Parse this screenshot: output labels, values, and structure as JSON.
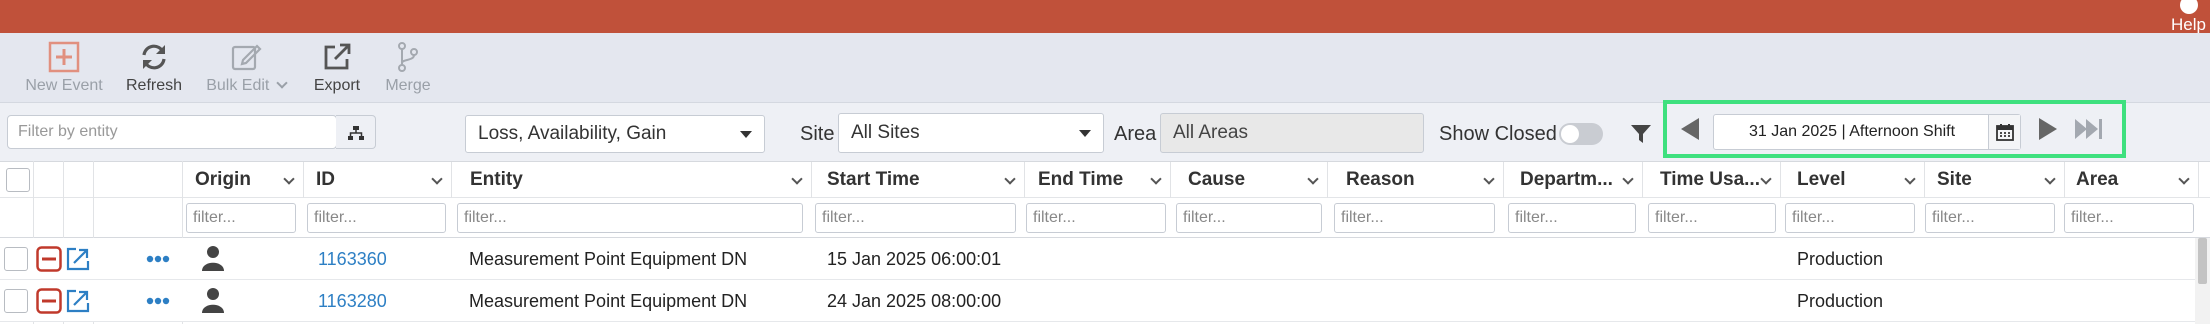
{
  "header": {
    "help_label": "Help"
  },
  "toolbar": {
    "new_event": "New Event",
    "refresh": "Refresh",
    "bulk_edit": "Bulk Edit",
    "export": "Export",
    "merge": "Merge"
  },
  "filters": {
    "entity_placeholder": "Filter by entity",
    "event_types": "Loss, Availability, Gain",
    "site_label": "Site",
    "site_value": "All Sites",
    "area_label": "Area",
    "area_value": "All Areas",
    "show_closed_label": "Show Closed",
    "show_closed_on": false
  },
  "date_nav": {
    "date": "31 Jan 2025",
    "separator": " | ",
    "shift": "Afternoon Shift"
  },
  "grid": {
    "columns": [
      "Origin",
      "ID",
      "Entity",
      "Start Time",
      "End Time",
      "Cause",
      "Reason",
      "Departm...",
      "Time Usa...",
      "Level",
      "Site",
      "Area"
    ],
    "filter_placeholder": "filter...",
    "rows": [
      {
        "id": "1163360",
        "entity": "Measurement Point Equipment DN",
        "start_time": "15 Jan 2025 06:00:01",
        "level": "Production"
      },
      {
        "id": "1163280",
        "entity": "Measurement Point Equipment DN",
        "start_time": "24 Jan 2025 08:00:00",
        "level": "Production"
      }
    ]
  },
  "colors": {
    "brand": "#c0513a",
    "highlight": "#3ee07e",
    "link": "#2d7fc4",
    "danger": "#c0392b"
  }
}
